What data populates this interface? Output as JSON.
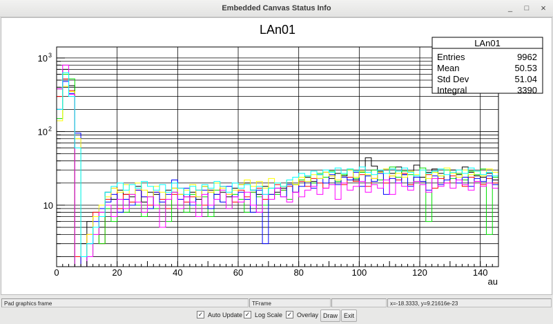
{
  "window": {
    "title": "Embedded Canvas Status Info",
    "minimize": "_",
    "maximize": "□",
    "close": "×"
  },
  "status_bar": [
    "Pad graphics frame",
    "TFrame",
    "",
    "x=-18.3333, y=9.21616e-23"
  ],
  "controls": {
    "auto_update": {
      "label": "Auto Update",
      "checked": true
    },
    "log_scale": {
      "label": "Log Scale",
      "checked": true
    },
    "overlay": {
      "label": "Overlay",
      "checked": true
    },
    "draw_label": "Draw",
    "exit_label": "Exit",
    "check_mark": "✓"
  },
  "stats": {
    "title": "LAn01",
    "rows": [
      {
        "label": "Entries",
        "value": "9962"
      },
      {
        "label": "Mean",
        "value": "50.53"
      },
      {
        "label": "Std Dev",
        "value": "51.04"
      },
      {
        "label": "Integral",
        "value": "3390"
      }
    ]
  },
  "chart_data": {
    "type": "histogram",
    "title": "LAn01",
    "xlabel": "au",
    "ylabel": "",
    "xlim": [
      0,
      146
    ],
    "ylim": [
      1.46,
      1410
    ],
    "yscale": "log",
    "bin_width": 2,
    "grid": true,
    "xticks": [
      "0",
      "20",
      "40",
      "60",
      "80",
      "100",
      "120",
      "140"
    ],
    "ytick_labels": [
      {
        "base": "10",
        "exp": "3",
        "value": 1000
      },
      {
        "base": "10",
        "exp": "2",
        "value": 100
      },
      {
        "base": "10",
        "exp": "",
        "value": 10
      }
    ],
    "series": [
      {
        "name": "black",
        "color": "#000000",
        "values": [
          380,
          700,
          420,
          1,
          3,
          6,
          7,
          5,
          15,
          12,
          16,
          14,
          13,
          18,
          11,
          15,
          14,
          12,
          16,
          17,
          14,
          13,
          15,
          12,
          18,
          16,
          14,
          15,
          13,
          17,
          19,
          20,
          16,
          14,
          18,
          12,
          15,
          17,
          20,
          19,
          22,
          24,
          21,
          26,
          28,
          23,
          27,
          25,
          30,
          22,
          28,
          44,
          34,
          29,
          31,
          27,
          33,
          26,
          29,
          35,
          24,
          28,
          31,
          27,
          22,
          30,
          26,
          33,
          28,
          25,
          24,
          27,
          22
        ]
      },
      {
        "name": "red",
        "color": "#ff0000",
        "values": [
          300,
          520,
          360,
          2,
          1,
          4,
          8,
          3,
          12,
          17,
          9,
          14,
          11,
          16,
          13,
          10,
          15,
          12,
          9,
          14,
          17,
          11,
          13,
          16,
          10,
          15,
          12,
          18,
          14,
          11,
          16,
          13,
          15,
          17,
          12,
          14,
          19,
          16,
          18,
          15,
          21,
          18,
          23,
          20,
          17,
          25,
          22,
          19,
          24,
          21,
          26,
          18,
          23,
          28,
          20,
          25,
          22,
          27,
          19,
          24,
          21,
          26,
          17,
          23,
          20,
          25,
          22,
          18,
          24,
          21,
          19,
          23,
          20
        ]
      },
      {
        "name": "green",
        "color": "#00e000",
        "values": [
          150,
          600,
          520,
          1,
          1,
          2,
          5,
          3,
          9,
          6,
          12,
          8,
          14,
          10,
          7,
          13,
          9,
          11,
          6,
          15,
          12,
          8,
          14,
          10,
          13,
          7,
          16,
          11,
          9,
          14,
          12,
          8,
          15,
          13,
          10,
          17,
          14,
          16,
          12,
          19,
          22,
          25,
          20,
          27,
          24,
          29,
          21,
          26,
          31,
          23,
          28,
          25,
          30,
          22,
          27,
          33,
          24,
          29,
          26,
          21,
          32,
          6,
          28,
          25,
          30,
          23,
          27,
          22,
          29,
          26,
          31,
          4,
          24
        ]
      },
      {
        "name": "blue",
        "color": "#0000ff",
        "values": [
          200,
          480,
          330,
          95,
          1,
          3,
          6,
          9,
          11,
          14,
          8,
          12,
          10,
          16,
          13,
          9,
          15,
          11,
          14,
          22,
          12,
          17,
          10,
          13,
          16,
          9,
          14,
          11,
          18,
          13,
          15,
          12,
          8,
          16,
          3,
          14,
          17,
          13,
          19,
          15,
          18,
          21,
          17,
          23,
          20,
          26,
          19,
          24,
          22,
          28,
          18,
          25,
          21,
          27,
          14,
          23,
          20,
          26,
          18,
          24,
          21,
          16,
          25,
          19,
          22,
          27,
          20,
          24,
          18,
          23,
          21,
          25,
          19
        ]
      },
      {
        "name": "yellow",
        "color": "#ffff00",
        "values": [
          140,
          410,
          350,
          80,
          2,
          4,
          7,
          10,
          13,
          17,
          15,
          19,
          14,
          20,
          16,
          13,
          18,
          15,
          12,
          17,
          14,
          16,
          19,
          13,
          18,
          15,
          20,
          17,
          14,
          16,
          19,
          22,
          18,
          21,
          17,
          23,
          20,
          18,
          22,
          19,
          24,
          21,
          26,
          23,
          28,
          25,
          22,
          27,
          30,
          24,
          29,
          26,
          23,
          28,
          31,
          25,
          27,
          24,
          29,
          26,
          30,
          23,
          28,
          25,
          32,
          27,
          24,
          30,
          26,
          29,
          25,
          31,
          28
        ]
      },
      {
        "name": "magenta",
        "color": "#ff00ff",
        "values": [
          380,
          800,
          320,
          1,
          1,
          2,
          4,
          8,
          10,
          7,
          12,
          9,
          14,
          11,
          8,
          13,
          10,
          5,
          12,
          15,
          9,
          13,
          11,
          7,
          14,
          10,
          12,
          16,
          9,
          13,
          11,
          15,
          10,
          8,
          14,
          12,
          17,
          13,
          11,
          15,
          13,
          16,
          18,
          14,
          17,
          19,
          12,
          20,
          16,
          18,
          21,
          15,
          19,
          17,
          22,
          14,
          20,
          18,
          16,
          21,
          19,
          15,
          23,
          18,
          20,
          17,
          22,
          19,
          16,
          21,
          18,
          20,
          17
        ]
      },
      {
        "name": "cyan",
        "color": "#00ffff",
        "values": [
          200,
          630,
          300,
          60,
          2,
          3,
          5,
          7,
          15,
          18,
          20,
          16,
          19,
          17,
          21,
          18,
          16,
          19,
          15,
          20,
          17,
          14,
          18,
          16,
          19,
          17,
          21,
          18,
          15,
          20,
          17,
          19,
          16,
          18,
          14,
          17,
          20,
          18,
          22,
          24,
          27,
          25,
          29,
          26,
          30,
          28,
          32,
          27,
          31,
          29,
          33,
          28,
          26,
          30,
          27,
          31,
          29,
          32,
          28,
          25,
          30,
          27,
          29,
          31,
          26,
          28,
          30,
          27,
          32,
          29,
          26,
          28,
          25
        ]
      }
    ]
  }
}
